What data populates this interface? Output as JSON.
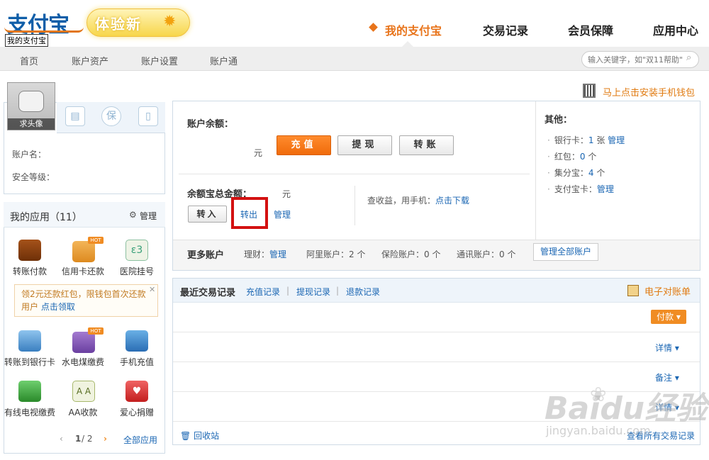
{
  "header": {
    "logo_text": "支付宝",
    "logo_caption": "我的支付宝",
    "badge": "体验新",
    "nav": [
      "我的支付宝",
      "交易记录",
      "会员保障",
      "应用中心"
    ],
    "subnav": [
      "首页",
      "账户资产",
      "账户设置",
      "账户通"
    ],
    "search_placeholder": "输入关键字，如\"双11帮助\""
  },
  "profile": {
    "avatar_caption": "求头像",
    "account_label": "账户名：",
    "security_label": "安全等级："
  },
  "apps": {
    "title": "我的应用（11）",
    "manage": "管理",
    "hot": "HOT",
    "row1": [
      "转账付款",
      "信用卡还款",
      "医院挂号"
    ],
    "promo_text": "领2元还款红包，限钱包首次还款用户",
    "promo_link": "点击领取",
    "row2": [
      "转账到银行卡",
      "水电煤缴费",
      "手机充值"
    ],
    "row3": [
      "有线电视缴费",
      "AA收款",
      "爱心捐赠"
    ],
    "page": "1",
    "page_total": "/ 2",
    "all_apps": "全部应用"
  },
  "mobile_wallet": "马上点击安装手机钱包",
  "balance": {
    "label": "账户余额：",
    "unit": "元",
    "recharge": "充值",
    "withdraw": "提现",
    "transfer": "转账",
    "yeb_label": "余额宝总金额：",
    "yeb_unit": "元",
    "transfer_in": "转入",
    "transfer_out": "转出",
    "manage": "管理",
    "mobile_tip": "查收益，用手机：",
    "mobile_link": "点击下载"
  },
  "other": {
    "title": "其他：",
    "bank_prefix": "银行卡：",
    "bank_count": "1",
    "bank_suffix": "张",
    "bank_manage": "管理",
    "hongbao_prefix": "红包：",
    "hongbao_count": "0",
    "hongbao_suffix": "个",
    "jifen_prefix": "集分宝：",
    "jifen_count": "4",
    "jifen_suffix": "个",
    "card_prefix": "支付宝卡：",
    "card_manage": "管理"
  },
  "more_accounts": {
    "label": "更多账户",
    "licai": "理财：",
    "licai_manage": "管理",
    "ali": "阿里账户：2 个",
    "insurance": "保险账户：0 个",
    "telecom": "通讯账户：0 个",
    "manage_all": "管理全部账户"
  },
  "transactions": {
    "title": "最近交易记录",
    "links": [
      "充值记录",
      "提现记录",
      "退款记录"
    ],
    "statement": "电子对账单",
    "pay": "付款",
    "actions": [
      "详情",
      "备注",
      "详情"
    ],
    "recycle": "回收站",
    "all": "查看所有交易记录"
  },
  "watermark": {
    "brand": "Bai",
    "brand2": "du经验",
    "sub": "jingyan.baidu.com"
  }
}
